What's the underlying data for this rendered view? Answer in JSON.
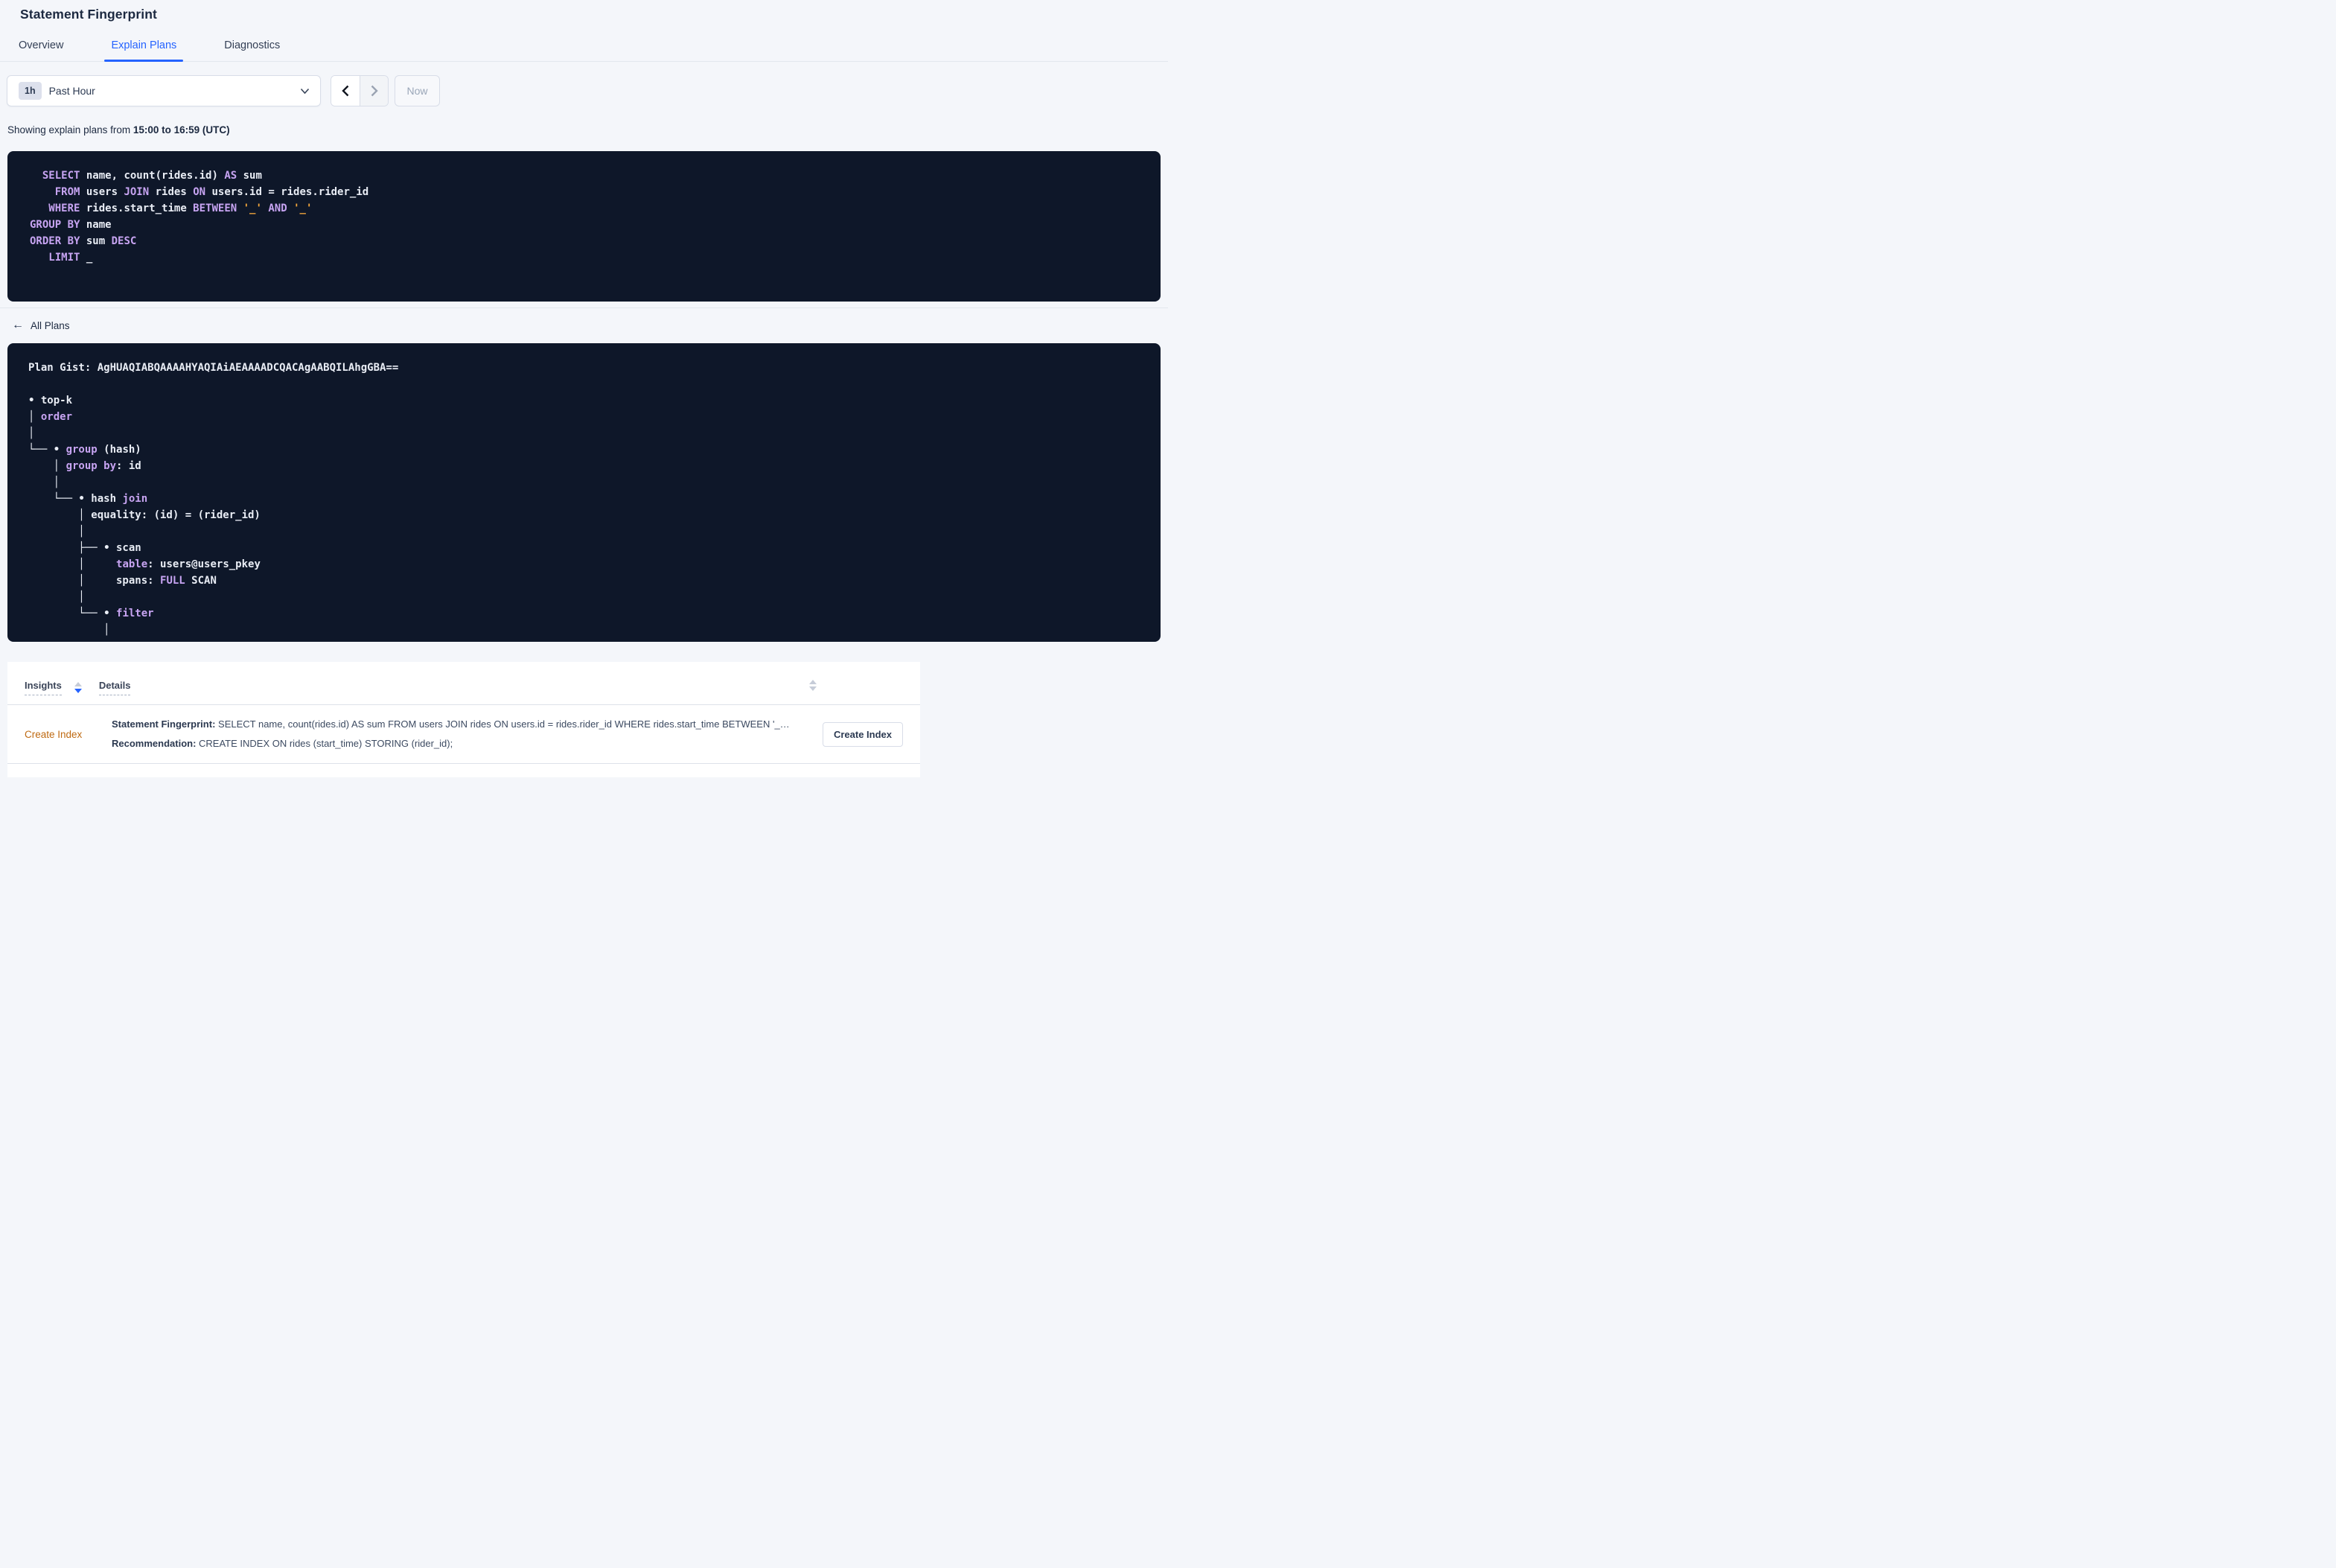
{
  "page": {
    "title": "Statement Fingerprint"
  },
  "tabs": [
    {
      "label": "Overview",
      "active": false
    },
    {
      "label": "Explain Plans",
      "active": true
    },
    {
      "label": "Diagnostics",
      "active": false
    }
  ],
  "time_picker": {
    "badge": "1h",
    "selected_label": "Past Hour",
    "now_label": "Now"
  },
  "range_caption": {
    "prefix": "Showing explain plans from ",
    "bold": "15:00 to 16:59 (UTC)"
  },
  "sql_block": {
    "lines": [
      [
        {
          "t": "tx",
          "v": "  "
        },
        {
          "t": "kw",
          "v": "SELECT"
        },
        {
          "t": "tx",
          "v": " name, count(rides.id) "
        },
        {
          "t": "kw",
          "v": "AS"
        },
        {
          "t": "tx",
          "v": " sum"
        }
      ],
      [
        {
          "t": "tx",
          "v": "    "
        },
        {
          "t": "kw",
          "v": "FROM"
        },
        {
          "t": "tx",
          "v": " users "
        },
        {
          "t": "kw",
          "v": "JOIN"
        },
        {
          "t": "tx",
          "v": " rides "
        },
        {
          "t": "kw",
          "v": "ON"
        },
        {
          "t": "tx",
          "v": " users.id = rides.rider_id"
        }
      ],
      [
        {
          "t": "tx",
          "v": "   "
        },
        {
          "t": "kw",
          "v": "WHERE"
        },
        {
          "t": "tx",
          "v": " rides.start_time "
        },
        {
          "t": "kw",
          "v": "BETWEEN"
        },
        {
          "t": "tx",
          "v": " "
        },
        {
          "t": "lit",
          "v": "'_'"
        },
        {
          "t": "tx",
          "v": " "
        },
        {
          "t": "kw",
          "v": "AND"
        },
        {
          "t": "tx",
          "v": " "
        },
        {
          "t": "lit",
          "v": "'_'"
        }
      ],
      [
        {
          "t": "kw",
          "v": "GROUP BY"
        },
        {
          "t": "tx",
          "v": " name"
        }
      ],
      [
        {
          "t": "kw",
          "v": "ORDER BY"
        },
        {
          "t": "tx",
          "v": " sum "
        },
        {
          "t": "kw",
          "v": "DESC"
        }
      ],
      [
        {
          "t": "tx",
          "v": "   "
        },
        {
          "t": "kw",
          "v": "LIMIT"
        },
        {
          "t": "tx",
          "v": " _"
        }
      ]
    ]
  },
  "all_plans": {
    "label": "All Plans"
  },
  "plan_block": {
    "lines": [
      [
        {
          "t": "tx",
          "v": "Plan Gist: AgHUAQIABQAAAAHYAQIAiAEAAAADCQACAgAABQILAhgGBA=="
        }
      ],
      [],
      [
        {
          "t": "tx",
          "v": "• top-k"
        }
      ],
      [
        {
          "t": "tx",
          "v": "│ "
        },
        {
          "t": "kw",
          "v": "order"
        }
      ],
      [
        {
          "t": "tx",
          "v": "│"
        }
      ],
      [
        {
          "t": "tx",
          "v": "└── • "
        },
        {
          "t": "kw",
          "v": "group"
        },
        {
          "t": "tx",
          "v": " (hash)"
        }
      ],
      [
        {
          "t": "tx",
          "v": "    │ "
        },
        {
          "t": "kw",
          "v": "group by"
        },
        {
          "t": "tx",
          "v": ": id"
        }
      ],
      [
        {
          "t": "tx",
          "v": "    │"
        }
      ],
      [
        {
          "t": "tx",
          "v": "    └── • hash "
        },
        {
          "t": "kw",
          "v": "join"
        }
      ],
      [
        {
          "t": "tx",
          "v": "        │ equality: (id) = (rider_id)"
        }
      ],
      [
        {
          "t": "tx",
          "v": "        │"
        }
      ],
      [
        {
          "t": "tx",
          "v": "        ├── • scan"
        }
      ],
      [
        {
          "t": "tx",
          "v": "        │     "
        },
        {
          "t": "kw",
          "v": "table"
        },
        {
          "t": "tx",
          "v": ": users@users_pkey"
        }
      ],
      [
        {
          "t": "tx",
          "v": "        │     spans: "
        },
        {
          "t": "kw",
          "v": "FULL"
        },
        {
          "t": "tx",
          "v": " SCAN"
        }
      ],
      [
        {
          "t": "tx",
          "v": "        │"
        }
      ],
      [
        {
          "t": "tx",
          "v": "        └── • "
        },
        {
          "t": "kw",
          "v": "filter"
        }
      ],
      [
        {
          "t": "tx",
          "v": "            │"
        }
      ]
    ]
  },
  "insights_table": {
    "columns": [
      {
        "label": "Insights",
        "sort": "desc"
      },
      {
        "label": "Details",
        "sort": "none"
      }
    ],
    "rows": [
      {
        "insight": "Create Index",
        "details": [
          {
            "label": "Statement Fingerprint:",
            "text": " SELECT name, count(rides.id) AS sum FROM users JOIN rides ON users.id = rides.rider_id WHERE rides.start_time BETWEEN '_…"
          },
          {
            "label": "Recommendation:",
            "text": " CREATE INDEX ON rides (start_time) STORING (rider_id);"
          }
        ],
        "action_label": "Create Index"
      }
    ]
  },
  "colors": {
    "accent": "#2563ff",
    "dark-card": "#0e1729",
    "kw": "#c7a4f2",
    "code": "#e9edf5",
    "lit": "#f6a83c",
    "link-orange": "#bf6a12",
    "page-bg": "#f4f6fa"
  }
}
